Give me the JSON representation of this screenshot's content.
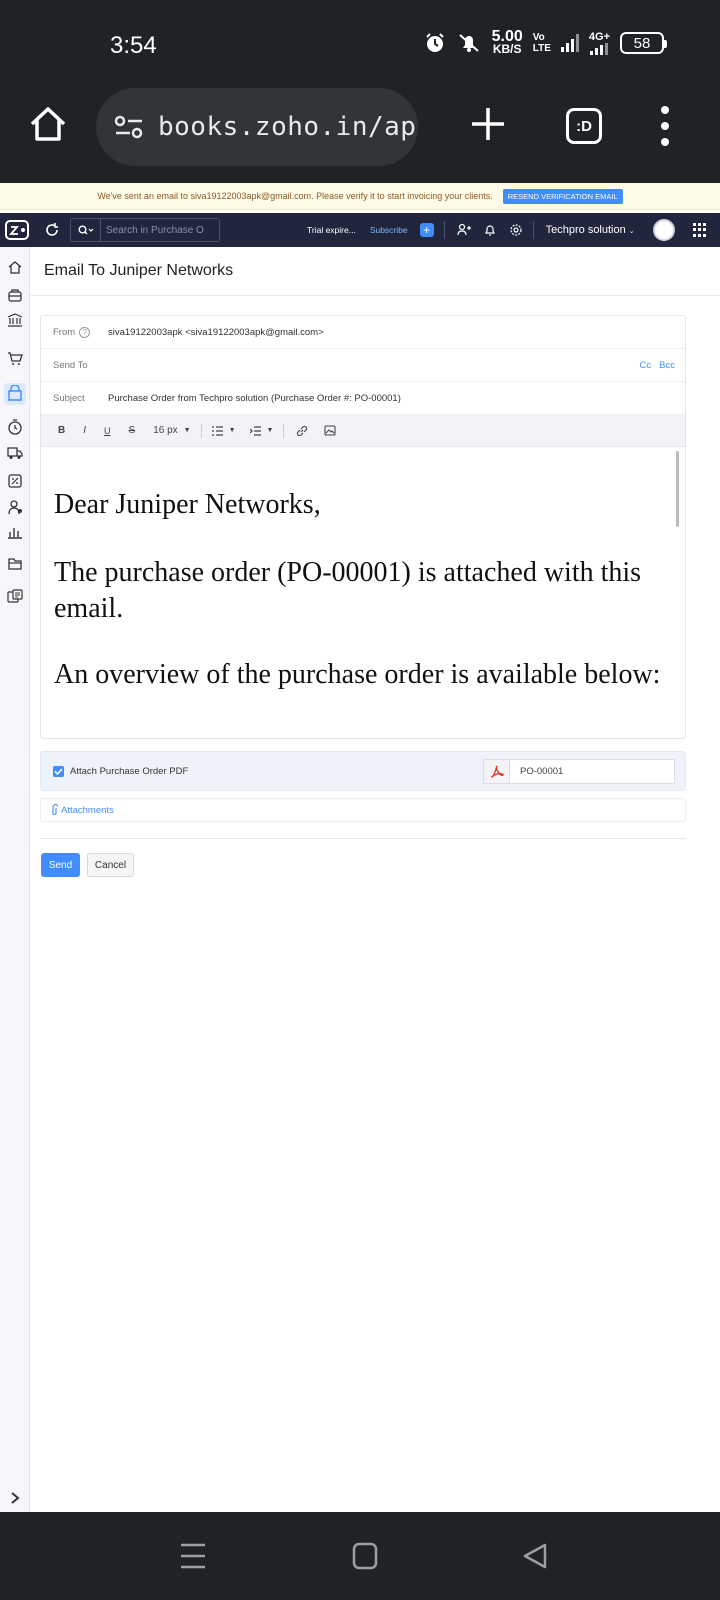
{
  "status_bar": {
    "time": "3:54",
    "net_speed_value": "5.00",
    "net_speed_unit": "KB/S",
    "volte_top": "Vo",
    "volte_bottom": "LTE",
    "network": "4G+",
    "battery": "58"
  },
  "browser": {
    "url": "books.zoho.in/ap",
    "tabs_label": ":D"
  },
  "banner": {
    "message": "We've sent an email to siva19122003apk@gmail.com. Please verify it to start invoicing your clients.",
    "resend_label": "RESEND VERIFICATION EMAIL"
  },
  "topbar": {
    "search_placeholder": "Search in Purchase O",
    "trial": "Trial expire...",
    "subscribe": "Subscribe",
    "quick_add": "+",
    "org_name": "Techpro solution"
  },
  "page": {
    "title": "Email To Juniper Networks"
  },
  "compose": {
    "from_label": "From",
    "from_value": "siva19122003apk <siva19122003apk@gmail.com>",
    "send_to_label": "Send To",
    "cc_label": "Cc",
    "bcc_label": "Bcc",
    "subject_label": "Subject",
    "subject_value": "Purchase Order from Techpro solution (Purchase Order #: PO-00001)",
    "toolbar": {
      "bold": "B",
      "italic": "I",
      "underline": "U",
      "strike": "S",
      "font_size": "16 px"
    },
    "body": {
      "greeting": "Dear Juniper Networks,",
      "line1": "The purchase order (PO-00001) is attached with this email.",
      "line2": "An overview of the purchase order is available below:"
    }
  },
  "attachment": {
    "checkbox_label": "Attach Purchase Order PDF",
    "checked": true,
    "file_name": "PO-00001",
    "attachments_label": "Attachments"
  },
  "actions": {
    "send": "Send",
    "cancel": "Cancel"
  },
  "colors": {
    "accent": "#408dfb",
    "topbar": "#21263c",
    "chrome": "#1f2326"
  }
}
